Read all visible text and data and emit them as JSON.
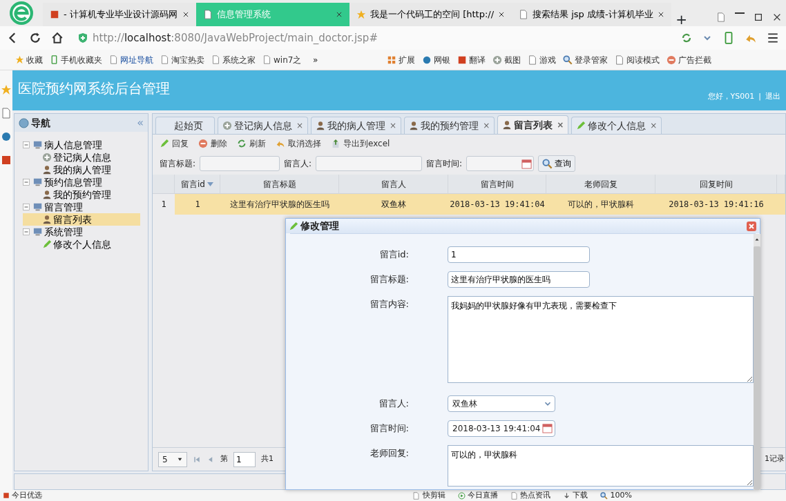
{
  "browser": {
    "tabs": [
      {
        "title": "- 计算机专业毕业设计源码网",
        "selected": false
      },
      {
        "title": "信息管理系统",
        "selected": true
      },
      {
        "title": "我是一个代码工的空间 [http://",
        "selected": false
      },
      {
        "title": "搜索结果 jsp 成绩-计算机毕业",
        "selected": false
      }
    ],
    "new_tab": "+",
    "address": "http://**localhost**:8080/JavaWebProject/main_doctor.jsp#",
    "bookmarks": [
      "收藏",
      "手机收藏夹",
      "网址导航",
      "淘宝热卖",
      "系统之家",
      "win7之"
    ],
    "more": "»",
    "extensions": [
      "扩展",
      "网银",
      "翻译",
      "截图",
      "游戏",
      "登录管家",
      "阅读模式",
      "广告拦截"
    ]
  },
  "app": {
    "title": "医院预约网系统后台管理",
    "greeting": "您好，YS001",
    "separator": "|",
    "logout": "退出"
  },
  "nav": {
    "title": "导航",
    "collapse": "«",
    "tree": [
      {
        "label": "病人信息管理",
        "expanded": true,
        "children": [
          {
            "label": "登记病人信息",
            "kind": "add",
            "selected": false
          },
          {
            "label": "我的病人管理",
            "kind": "user",
            "selected": false
          }
        ]
      },
      {
        "label": "预约信息管理",
        "expanded": true,
        "children": [
          {
            "label": "我的预约管理",
            "kind": "user",
            "selected": false
          }
        ]
      },
      {
        "label": "留言管理",
        "expanded": true,
        "children": [
          {
            "label": "留言列表",
            "kind": "user",
            "selected": true
          }
        ]
      },
      {
        "label": "系统管理",
        "expanded": true,
        "children": [
          {
            "label": "修改个人信息",
            "kind": "edit",
            "selected": false
          }
        ]
      }
    ]
  },
  "tabs": [
    {
      "label": "起始页",
      "kind": "plain",
      "selected": false
    },
    {
      "label": "登记病人信息",
      "kind": "add",
      "close": "×",
      "selected": false
    },
    {
      "label": "我的病人管理",
      "kind": "user",
      "close": "×",
      "selected": false
    },
    {
      "label": "我的预约管理",
      "kind": "user",
      "close": "×",
      "selected": false
    },
    {
      "label": "留言列表",
      "kind": "user",
      "close": "×",
      "selected": true
    },
    {
      "label": "修改个人信息",
      "kind": "edit",
      "close": "×",
      "selected": false
    }
  ],
  "toolbar": [
    {
      "label": "回复",
      "kind": "edit"
    },
    {
      "label": "删除",
      "kind": "remove"
    },
    {
      "label": "刷新",
      "kind": "reload"
    },
    {
      "label": "取消选择",
      "kind": "undo"
    },
    {
      "label": "导出到excel",
      "kind": "export"
    }
  ],
  "search": {
    "fields": [
      {
        "label": "留言标题:",
        "kind": "text"
      },
      {
        "label": "留言人:",
        "kind": "text"
      },
      {
        "label": "留言时间:",
        "kind": "date"
      }
    ],
    "button": "查询"
  },
  "grid": {
    "columns": [
      {
        "label": "留言id",
        "sorted": true
      },
      {
        "label": "留言标题",
        "sorted": false
      },
      {
        "label": "留言人",
        "sorted": false
      },
      {
        "label": "留言时间",
        "sorted": false
      },
      {
        "label": "老师回复",
        "sorted": false
      },
      {
        "label": "回复时间",
        "sorted": false
      }
    ],
    "rows": [
      {
        "number": "1",
        "selected": true,
        "cells": [
          "1",
          "这里有治疗甲状腺的医生吗",
          "双鱼林",
          "2018-03-13 19:41:04",
          "可以的，甲状腺科",
          "2018-03-13 19:41:16"
        ]
      }
    ]
  },
  "pager": {
    "page_size": "5",
    "page_label": "第",
    "page": "1",
    "total": "共1",
    "records": "1记录"
  },
  "dialog": {
    "title": "修改管理",
    "fields": [
      {
        "label": "留言id:",
        "value": "1",
        "kind": "text"
      },
      {
        "label": "留言标题:",
        "value": "这里有治疗甲状腺的医生吗",
        "kind": "text"
      },
      {
        "label": "留言内容:",
        "value": "我妈妈的甲状腺好像有甲亢表现，需要检查下",
        "kind": "textarea"
      },
      {
        "label": "留言人:",
        "value": "双鱼林",
        "kind": "select"
      },
      {
        "label": "留言时间:",
        "value": "2018-03-13 19:41:04",
        "kind": "date"
      },
      {
        "label": "老师回复:",
        "value": "可以的，甲状腺科",
        "kind": "textarea"
      }
    ]
  },
  "status_bar": {
    "left": "今日优选",
    "items": [
      "快剪辑",
      "今日直播",
      "热点资讯",
      "下载",
      "100%"
    ]
  }
}
